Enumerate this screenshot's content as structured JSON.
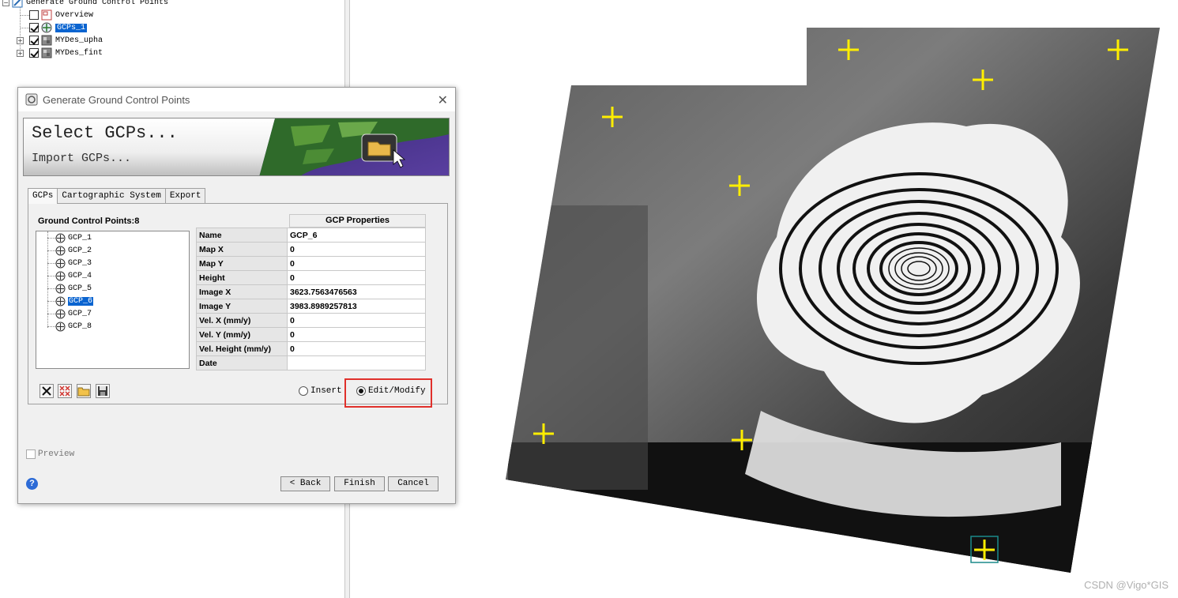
{
  "layer_tree": {
    "root": "Generate Ground Control Points",
    "items": [
      {
        "label": "Overview",
        "checked": false,
        "icon": "overview-icon"
      },
      {
        "label": "GCPs_1",
        "checked": true,
        "icon": "gcp-layer-icon",
        "selected": true
      },
      {
        "label": "MYDes_upha",
        "checked": true,
        "icon": "raster-icon",
        "expander": "+"
      },
      {
        "label": "MYDes_fint",
        "checked": true,
        "icon": "raster-icon",
        "expander": "+"
      }
    ]
  },
  "map": {
    "watermark": "CSDN @Vigo*GIS",
    "marker_color": "#ffee00",
    "selected_marker_color": "#1b8a8a"
  },
  "dialog": {
    "title": "Generate Ground Control Points",
    "close_icon": "close-icon",
    "banner": {
      "line1": "Select GCPs...",
      "line2": "Import GCPs..."
    },
    "tabs": [
      "GCPs",
      "Cartographic System",
      "Export"
    ],
    "active_tab": "GCPs",
    "gcp_count_label": "Ground Control Points:",
    "gcp_count": "8",
    "gcps": [
      "GCP_1",
      "GCP_2",
      "GCP_3",
      "GCP_4",
      "GCP_5",
      "GCP_6",
      "GCP_7",
      "GCP_8"
    ],
    "selected_gcp": "GCP_6",
    "props_header": "GCP Properties",
    "properties": [
      {
        "key": "Name",
        "value": "GCP_6"
      },
      {
        "key": "Map X",
        "value": "0"
      },
      {
        "key": "Map Y",
        "value": "0"
      },
      {
        "key": "Height",
        "value": "0"
      },
      {
        "key": "Image X",
        "value": "3623.7563476563"
      },
      {
        "key": "Image Y",
        "value": "3983.8989257813"
      },
      {
        "key": "Vel. X (mm/y)",
        "value": "0"
      },
      {
        "key": "Vel. Y (mm/y)",
        "value": "0"
      },
      {
        "key": "Vel. Height (mm/y)",
        "value": "0"
      },
      {
        "key": "Date",
        "value": ""
      }
    ],
    "toolbar_icons": [
      "delete-icon",
      "delete-all-icon",
      "open-folder-icon",
      "save-icon"
    ],
    "mode": {
      "insert_label": "Insert",
      "edit_label": "Edit/Modify",
      "selected": "Edit/Modify"
    },
    "preview_label": "Preview",
    "buttons": {
      "back": "< Back",
      "finish": "Finish",
      "cancel": "Cancel"
    },
    "accent_highlight": "#e0302b"
  }
}
